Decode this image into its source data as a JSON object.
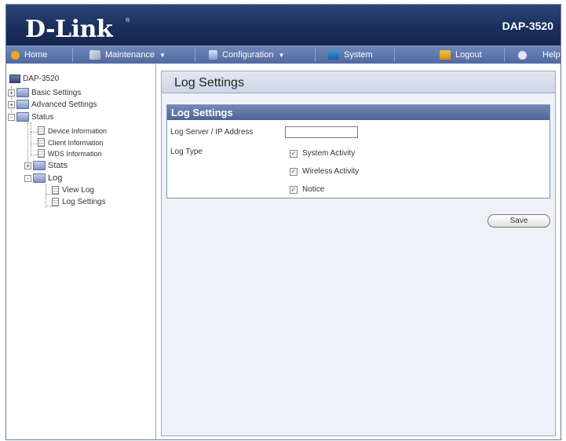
{
  "header": {
    "brand": "D-Link",
    "brand_mark": "®",
    "model": "DAP-3520"
  },
  "menu": {
    "home": "Home",
    "maintenance": "Maintenance",
    "configuration": "Configuration",
    "system": "System",
    "logout": "Logout",
    "help": "Help"
  },
  "tree": {
    "root": "DAP-3520",
    "basic_settings": "Basic Settings",
    "advanced_settings": "Advanced Settings",
    "status": "Status",
    "device_information": "Device Information",
    "client_information": "Client Information",
    "wds_information": "WDS Information",
    "stats": "Stats",
    "log": "Log",
    "view_log": "View Log",
    "log_settings": "Log Settings"
  },
  "main": {
    "page_title": "Log Settings",
    "section_title": "Log Settings",
    "log_server_label": "Log Server / IP Address",
    "log_server_value": "",
    "log_type_label": "Log Type",
    "checks": {
      "system_activity": "System Activity",
      "wireless_activity": "Wireless Activity",
      "notice": "Notice"
    },
    "save_label": "Save"
  },
  "colors": {
    "banner": "#1a2f5e",
    "menubar": "#5169a0",
    "section_header": "#4e6498",
    "content_bg": "#eef1f7"
  }
}
